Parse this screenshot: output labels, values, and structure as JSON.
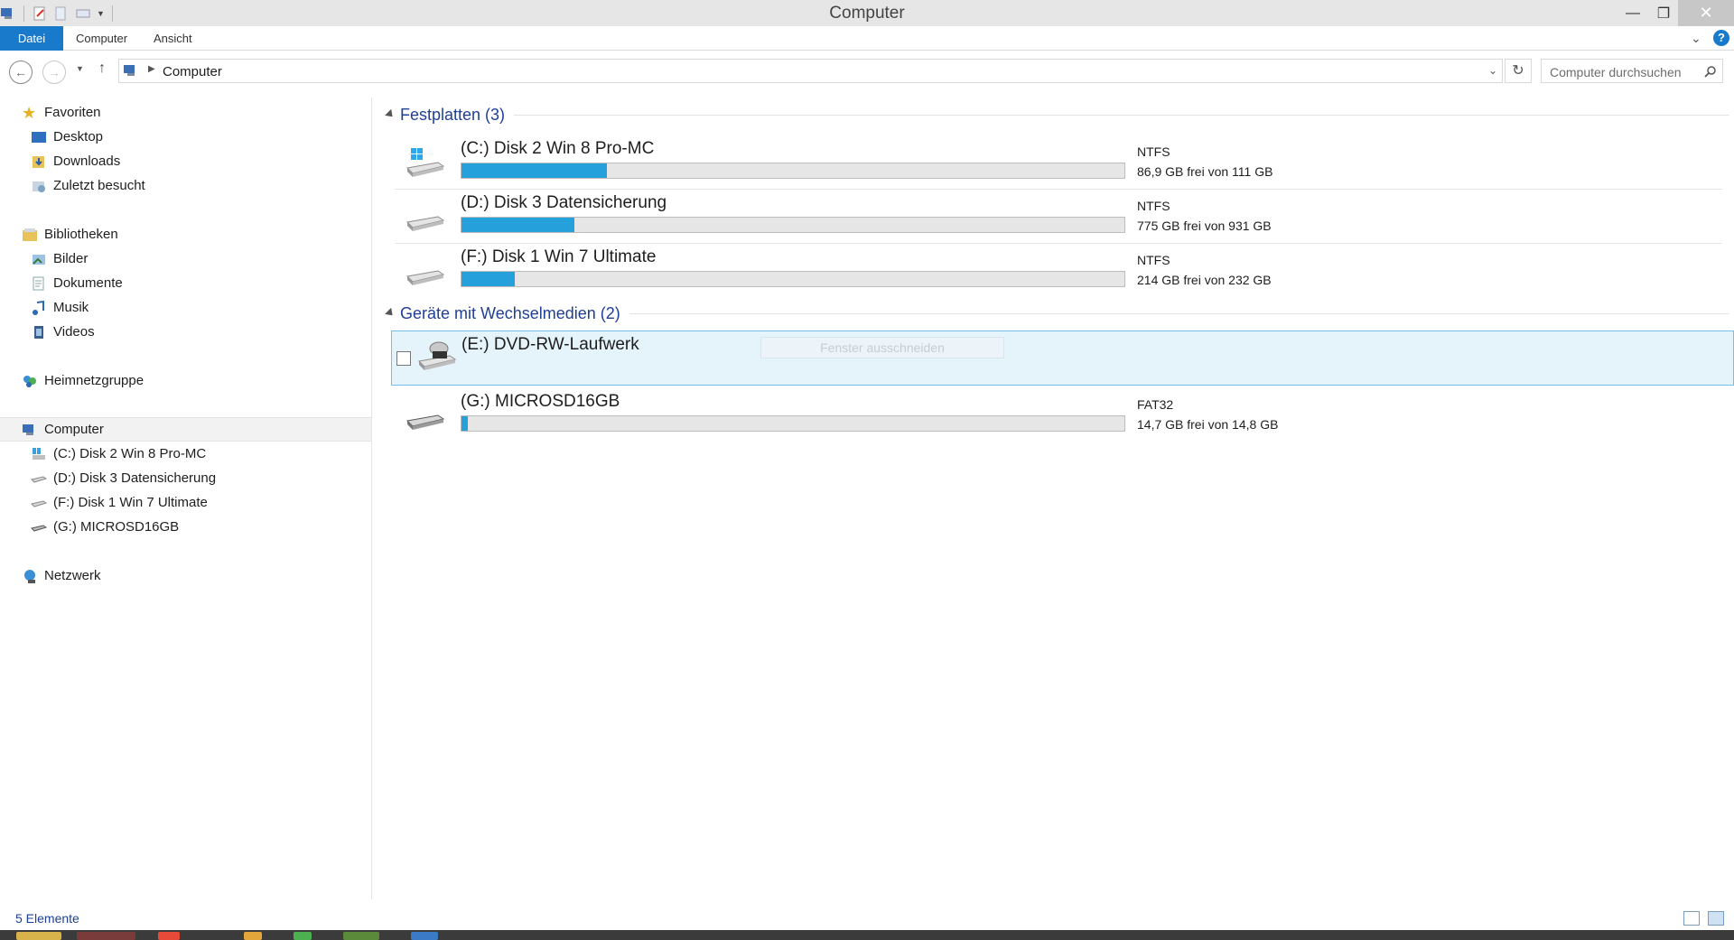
{
  "window": {
    "title": "Computer"
  },
  "ribbon": {
    "tabs": [
      "Datei",
      "Computer",
      "Ansicht"
    ]
  },
  "navbar": {
    "address": "Computer",
    "search_placeholder": "Computer durchsuchen"
  },
  "sidebar": {
    "favorites": {
      "label": "Favoriten",
      "items": [
        "Desktop",
        "Downloads",
        "Zuletzt besucht"
      ]
    },
    "libraries": {
      "label": "Bibliotheken",
      "items": [
        "Bilder",
        "Dokumente",
        "Musik",
        "Videos"
      ]
    },
    "homegroup": {
      "label": "Heimnetzgruppe"
    },
    "computer": {
      "label": "Computer",
      "items": [
        "(C:) Disk 2 Win 8 Pro-MC",
        "(D:) Disk 3 Datensicherung",
        "(F:) Disk 1 Win 7 Ultimate",
        "(G:) MICROSD16GB"
      ]
    },
    "network": {
      "label": "Netzwerk"
    }
  },
  "main": {
    "groups": [
      {
        "label": "Festplatten (3)"
      },
      {
        "label": "Geräte mit Wechselmedien (2)"
      }
    ],
    "drives": [
      {
        "name": "(C:) Disk 2 Win 8 Pro-MC",
        "fs": "NTFS",
        "free": "86,9 GB frei von 111 GB",
        "used_fraction": 0.22
      },
      {
        "name": "(D:) Disk 3 Datensicherung",
        "fs": "NTFS",
        "free": "775 GB frei von 931 GB",
        "used_fraction": 0.17
      },
      {
        "name": "(F:) Disk 1 Win 7 Ultimate",
        "fs": "NTFS",
        "free": "214 GB frei von 232 GB",
        "used_fraction": 0.08
      },
      {
        "name": "(E:) DVD-RW-Laufwerk",
        "tooltip": "Fenster ausschneiden"
      },
      {
        "name": "(G:) MICROSD16GB",
        "fs": "FAT32",
        "free": "14,7 GB frei von 14,8 GB",
        "used_fraction": 0.01
      }
    ]
  },
  "status": {
    "count": "5 Elemente"
  },
  "colors": {
    "accent": "#1979ca",
    "bar_fill": "#26a0da",
    "selection": "#e5f3fb"
  }
}
